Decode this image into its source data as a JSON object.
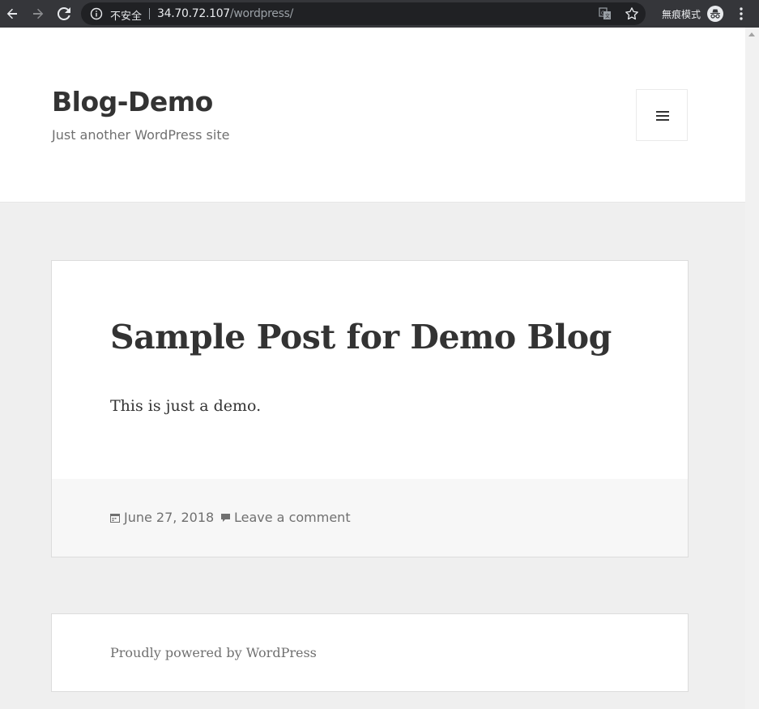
{
  "browser": {
    "security_label": "不安全",
    "url_host": "34.70.72.107",
    "url_path": "/wordpress/",
    "incognito_label": "無痕模式",
    "icons": [
      "back-icon",
      "forward-icon",
      "reload-icon",
      "info-icon",
      "translate-icon",
      "star-icon",
      "incognito-icon",
      "more-menu-icon"
    ]
  },
  "site": {
    "title": "Blog-Demo",
    "description": "Just another WordPress site"
  },
  "post": {
    "title": "Sample Post for Demo Blog",
    "content": "This is just a demo.",
    "date": "June 27, 2018",
    "comment_link": "Leave a comment"
  },
  "footer": {
    "powered_by": "Proudly powered by WordPress"
  },
  "colors": {
    "chrome_bg": "#35363a",
    "omnibox_bg": "#202124",
    "page_bg": "#efefef",
    "text_dark": "#333333",
    "text_muted": "#707070"
  }
}
